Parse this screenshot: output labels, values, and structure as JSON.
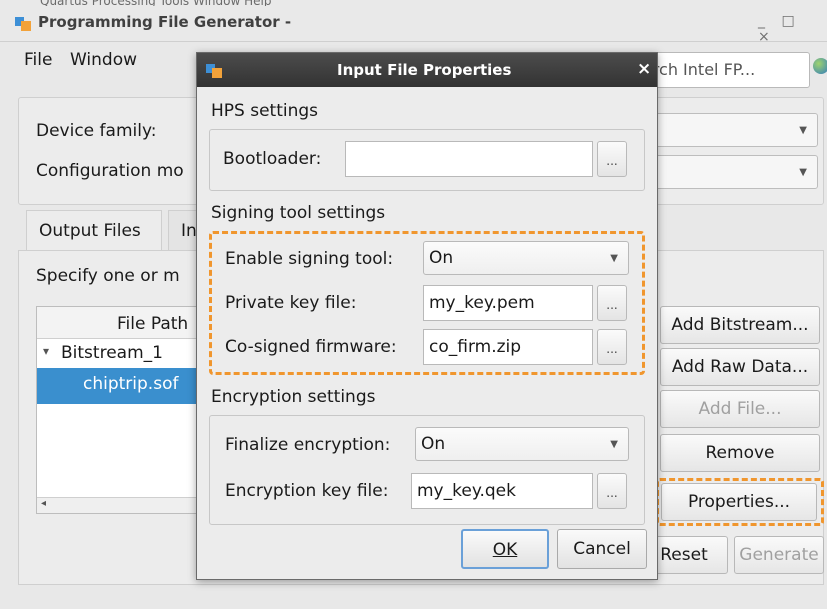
{
  "main_window": {
    "title": "Programming File Generator -",
    "clipped_menu_text": "Quartus  Processing  Tools  Window  Help",
    "window_controls": "_ □ ×",
    "menu": [
      "File",
      "Window"
    ],
    "search_placeholder": "arch Intel FP...",
    "device_family_label": "Device family:",
    "configuration_label": "Configuration mo",
    "tabs": [
      "Output Files",
      "In"
    ],
    "panel_hint": "Specify one or m",
    "table": {
      "header": "File Path",
      "rows": [
        {
          "label": "Bitstream_1",
          "expander": "▾"
        },
        {
          "label": "chiptrip.sof",
          "selected": true
        }
      ]
    },
    "side_buttons": [
      "Add Bitstream...",
      "Add Raw Data...",
      "Add File...",
      "Remove",
      "Properties..."
    ],
    "bottom_buttons": [
      "Reset",
      "Generate"
    ]
  },
  "dialog": {
    "title": "Input File Properties",
    "close": "×",
    "hps_section": "HPS settings",
    "bootloader_label": "Bootloader:",
    "bootloader_value": "",
    "signing_section": "Signing tool settings",
    "enable_signing_label": "Enable signing tool:",
    "enable_signing_value": "On",
    "private_key_label": "Private key file:",
    "private_key_value": "my_key.pem",
    "cosigned_label": "Co-signed firmware:",
    "cosigned_value": "co_firm.zip",
    "encryption_section": "Encryption settings",
    "finalize_label": "Finalize encryption:",
    "finalize_value": "On",
    "enc_key_label": "Encryption key file:",
    "enc_key_value": "my_key.qek",
    "browse": "...",
    "ok": "OK",
    "cancel": "Cancel"
  },
  "colors": {
    "highlight_dash": "#f0962e",
    "selection": "#3a8fce",
    "dialog_titlebar": "#3a3a3a"
  }
}
